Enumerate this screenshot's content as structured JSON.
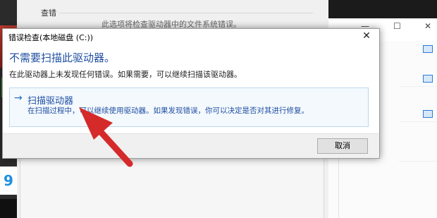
{
  "background_window": {
    "group_label": "查错",
    "partial_text": "此选项将检查驱动器中的文件系统错误。"
  },
  "dialog": {
    "title": "错误检查(本地磁盘 (C:))",
    "close_glyph": "✕",
    "headline": "不需要扫描此驱动器。",
    "description": "在此驱动器上未发现任何错误。如果需要，可以继续扫描该驱动器。",
    "scan_option": {
      "arrow_glyph": "→",
      "title": "扫描驱动器",
      "description": "在扫描过程中，可以继续使用驱动器。如果发现错误，你可以决定是否对其进行修复。"
    },
    "cancel_label": "取消"
  },
  "explorer": {
    "minimize_glyph": "—",
    "maximize_glyph": "☐",
    "close_glyph": "✕"
  },
  "app_tile_letter": "9",
  "colors": {
    "accent_blue": "#1f4fa2",
    "annotation_red": "#d52a2a"
  },
  "icons": [
    "close-icon",
    "arrow-right-icon",
    "minimize-icon",
    "maximize-icon",
    "folder-icon",
    "annotation-arrow"
  ]
}
